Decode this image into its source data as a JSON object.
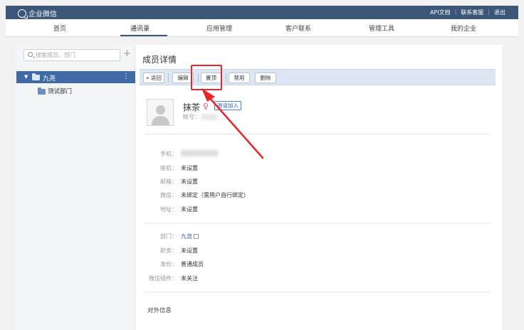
{
  "app": {
    "title": "企业微信"
  },
  "top_links": [
    "API文档",
    "联系客服",
    "退出"
  ],
  "nav": {
    "items": [
      "首页",
      "通讯录",
      "应用管理",
      "客户联系",
      "管理工具",
      "我的企业"
    ],
    "active": "通讯录"
  },
  "sidebar": {
    "search_placeholder": "搜索成员、部门",
    "add_label": "+",
    "tree": {
      "root": {
        "name": "九尧",
        "more": "⋮"
      },
      "children": [
        {
          "name": "测试部门"
        }
      ]
    }
  },
  "main": {
    "title": "成员详情",
    "toolbar": {
      "back": "« 返回",
      "edit": "编辑",
      "top": "置顶",
      "disable": "禁用",
      "delete": "删除"
    },
    "member": {
      "name": "抹茶",
      "gender_symbol": "♀",
      "invite_label": "邀请加入",
      "account_label": "帐号："
    },
    "fields": {
      "phone_label": "手机：",
      "landline_label": "座机：",
      "landline_value": "未设置",
      "email_label": "邮箱：",
      "email_value": "未设置",
      "wechat_label": "微信：",
      "wechat_value": "未绑定（需用户自行绑定）",
      "address_label": "地址：",
      "address_value": "未设置",
      "dept_label": "部门：",
      "dept_value": "九尧",
      "position_label": "职务：",
      "position_value": "未设置",
      "identity_label": "身份：",
      "identity_value": "普通成员",
      "plugin_label": "微信插件：",
      "plugin_value": "未关注"
    },
    "external_section": "对外信息"
  },
  "colors": {
    "topbar": "#3b5677",
    "tree_selected": "#3f6aa6",
    "toolbar": "#dce7f3",
    "annotation": "#e8262d"
  }
}
